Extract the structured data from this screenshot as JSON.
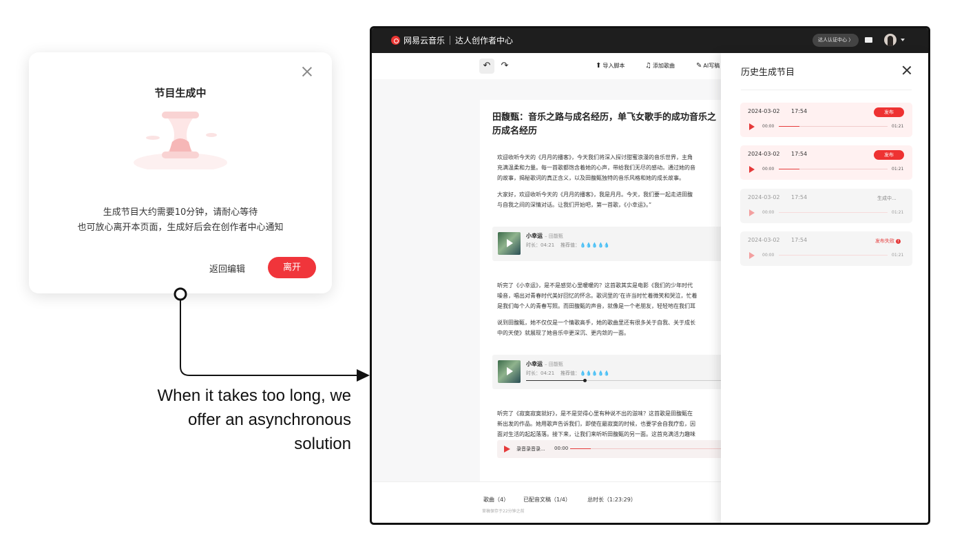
{
  "colors": {
    "accent": "#f0353b",
    "topbar": "#1e1e1e"
  },
  "modal": {
    "title": "节目生成中",
    "message_line1": "生成节目大约需要10分钟，请耐心等待",
    "message_line2": "也可放心离开本页面，生成好后会在创作者中心通知",
    "back_label": "返回编辑",
    "leave_label": "离开",
    "close_icon": "close-icon",
    "illustration": "hourglass-illustration"
  },
  "caption": {
    "line1": "When it takes too long, we",
    "line2": "offer an asynchronous",
    "line3": "solution"
  },
  "app": {
    "brand": "网易云音乐",
    "subtitle": "达人创作者中心",
    "verify_label": "达人认证中心 〉",
    "toolbar": {
      "undo_icon": "undo-icon",
      "redo_icon": "redo-icon",
      "import_label": "导入脚本",
      "add_song_label": "添加歌曲",
      "ai_label": "AI写稿"
    },
    "doc": {
      "title_line1": "田馥甄：音乐之路与成名经历，单飞女歌手的成功音乐之",
      "title_line2": "历成名经历",
      "p1": [
        "欢迎收听今天的《月月的播客》，今天我们将深入探讨甜蜜浪漫的音乐世界，主角",
        "充满温柔和力量。每一首歌都饱含着她的心声，带给我们无尽的感动。通过她的音",
        "的故事，揭秘歌词的真正含义，以及田馥甄独特的音乐风格和她的成长故事。"
      ],
      "p2": [
        "大家好，欢迎收听今天的《月月的播客》，我是月月。今天，我们要一起走进田馥",
        "与自我之间的深情对话。让我们开始吧，第一首歌，《小幸运》。”"
      ],
      "p3": [
        "听完了《小幸运》，是不是感觉心里暖暖的？这首歌其实是电影《我们的少年时代",
        "噪音，唱出对青春时代美好回忆的怀念。歌词里的‘在许当时忙着微笑和哭泣，忙着",
        "是我们每个人的青春写照。而田馥甄的声音，就像是一个老朋友，轻轻地在我们耳"
      ],
      "p4": [
        "说到田馥甄，她不仅仅是一个情歌高手，她的歌曲里还有很多关于自我、关于成长",
        "中的天使》就展现了她音乐中更深沉、更内敛的一面。"
      ],
      "p5": [
        "听完了《寂寞寂寞就好》，是不是觉得心里有种说不出的滋味？这首歌是田馥甄在",
        "新出发的作品。她用歌声告诉我们，即使在最寂寞的时候，也要学会自我疗愈，因",
        "面对生活的起起落落。接下来，让我们来听听田馥甄的另一面。这首充满活力趣味"
      ],
      "song": {
        "name": "小幸运",
        "artist": "– 田馥甄",
        "duration": "时长：04:21",
        "rating": "推荐值：💧💧💧💧💧"
      },
      "recording": {
        "label": "录音录音录...",
        "time": "00:00"
      }
    },
    "footer": {
      "songs": "歌曲（4）",
      "scripts": "已配音文稿（1/4）",
      "total": "总时长（1:23:29）",
      "saved": "草稿保存于22分钟之前"
    },
    "history": {
      "title": "历史生成节目",
      "items": [
        {
          "date": "2024-03-02",
          "time": "17:54",
          "status": "发布",
          "start": "00:00",
          "end": "01:21",
          "progress": 0.19
        },
        {
          "date": "2024-03-02",
          "time": "17:54",
          "status": "发布",
          "start": "00:00",
          "end": "01:21",
          "progress": 0.19
        },
        {
          "date": "2024-03-02",
          "time": "17:54",
          "status": "生成中...",
          "start": "00:00",
          "end": "01:21"
        },
        {
          "date": "2024-03-02",
          "time": "17:54",
          "status": "发布失败",
          "start": "00:00",
          "end": "01:21"
        }
      ]
    }
  }
}
